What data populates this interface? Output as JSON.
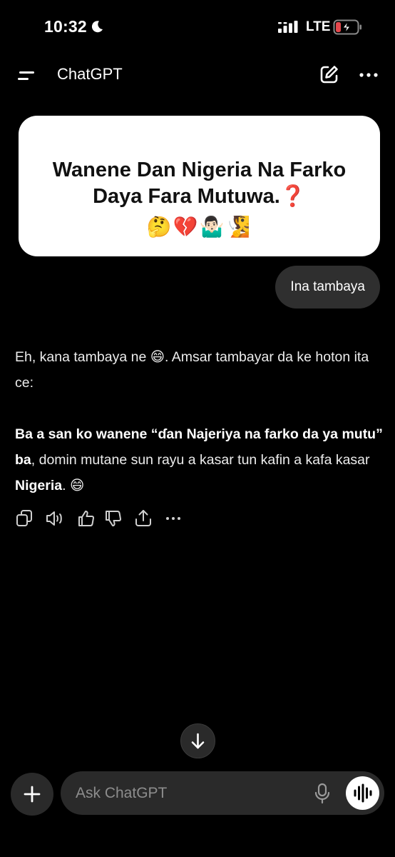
{
  "status_bar": {
    "time": "10:32",
    "network": "LTE",
    "icons": [
      "moon-icon",
      "signal-icon",
      "battery-charging-icon"
    ]
  },
  "header": {
    "title": "ChatGPT",
    "icons": [
      "menu-icon",
      "new-chat-icon",
      "more-icon"
    ]
  },
  "conversation": {
    "attached_image": {
      "line1": "Wanene Dan Nigeria Na Farko",
      "line2": "Daya Fara Mutuwa.❓",
      "emojis": "🤔💔🤷🏻‍♂️🧏"
    },
    "user_message": "Ina tambaya",
    "assistant": {
      "p1": "Eh, kana tambaya ne 😄. Amsar tambayar da ke hoton ita ce:",
      "p2_bold": "Ba a san ko wanene “ɗan Najeriya na farko da ya mutu” ba",
      "p2_rest": ", domin mutane sun rayu a kasar tun kafin a kafa kasar ",
      "p2_bold2": "Nigeria",
      "p2_end": ". 😄"
    },
    "action_icons": [
      "copy-icon",
      "read-aloud-icon",
      "thumbs-up-icon",
      "thumbs-down-icon",
      "share-icon",
      "more-icon"
    ]
  },
  "composer": {
    "placeholder": "Ask ChatGPT",
    "icons": [
      "plus-icon",
      "mic-icon",
      "voice-mode-icon",
      "arrow-down-icon"
    ]
  },
  "colors": {
    "background": "#000000",
    "bubble": "#2f2f2f",
    "composer": "#2a2a2a",
    "battery_accent": "#e5484d"
  }
}
